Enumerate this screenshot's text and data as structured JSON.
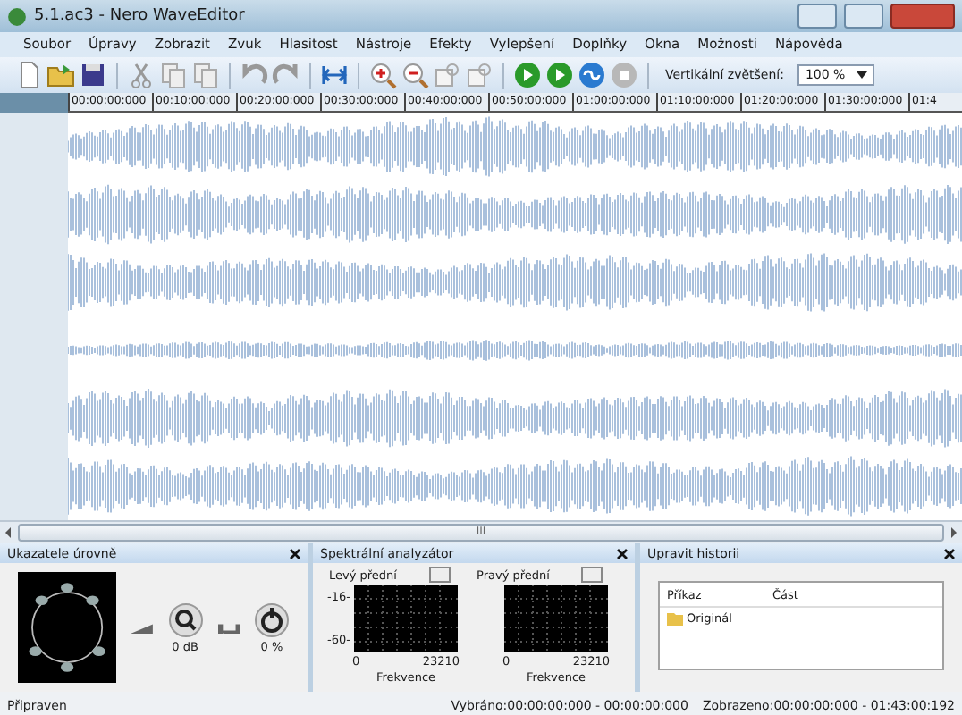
{
  "window": {
    "title": "5.1.ac3 - Nero WaveEditor"
  },
  "menu": [
    "Soubor",
    "Úpravy",
    "Zobrazit",
    "Zvuk",
    "Hlasitost",
    "Nástroje",
    "Efekty",
    "Vylepšení",
    "Doplňky",
    "Okna",
    "Možnosti",
    "Nápověda"
  ],
  "toolbar": {
    "zoom_label": "Vertikální zvětšení:",
    "zoom_value": "100 %"
  },
  "ruler": [
    "00:00:00:000",
    "00:10:00:000",
    "00:20:00:000",
    "00:30:00:000",
    "00:40:00:000",
    "00:50:00:000",
    "01:00:00:000",
    "01:10:00:000",
    "01:20:00:000",
    "01:30:00:000",
    "01:4"
  ],
  "scrollbar": {
    "grip": "III"
  },
  "level_panel": {
    "title": "Ukazatele úrovně",
    "gain": "0 dB",
    "mix": "0 %"
  },
  "spectrum_panel": {
    "title": "Spektrální analyzátor",
    "channels": [
      {
        "name": "Levý přední",
        "ytick_top": "-16-",
        "ytick_bottom": "-60-",
        "x_min": "0",
        "x_max": "23210",
        "xlabel": "Frekvence"
      },
      {
        "name": "Pravý přední",
        "x_min": "0",
        "x_max": "23210",
        "xlabel": "Frekvence"
      }
    ]
  },
  "history_panel": {
    "title": "Upravit historii",
    "columns": [
      "Příkaz",
      "Část"
    ],
    "rows": [
      {
        "command": "Originál",
        "selected": false
      }
    ]
  },
  "status_bar": {
    "state": "Připraven",
    "selection": "Vybráno:00:00:00:000 - 00:00:00:000",
    "view": "Zobrazeno:00:00:00:000 - 01:43:00:192"
  }
}
